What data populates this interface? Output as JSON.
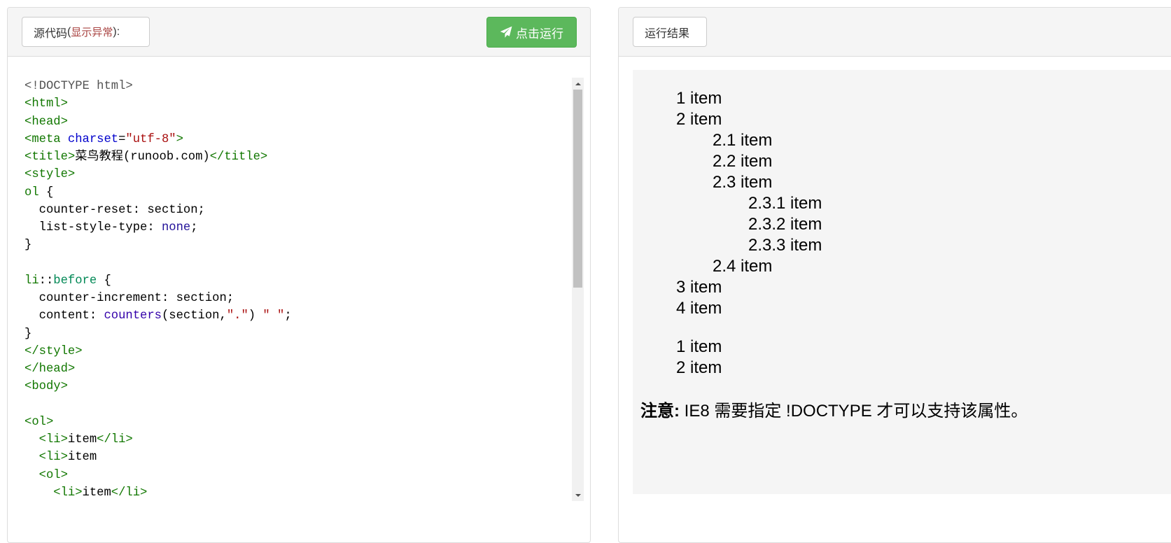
{
  "source_panel": {
    "label": "源代码",
    "error_open": " (",
    "error_link": "显示异常",
    "error_close": ")",
    "label_colon": ":",
    "run_button": "点击运行",
    "code_lines": [
      [
        {
          "t": "doc",
          "v": "<!DOCTYPE html>"
        }
      ],
      [
        {
          "t": "tag",
          "v": "<html>"
        }
      ],
      [
        {
          "t": "tag",
          "v": "<head>"
        }
      ],
      [
        {
          "t": "tag",
          "v": "<meta "
        },
        {
          "t": "attr",
          "v": "charset"
        },
        {
          "t": "",
          "v": "="
        },
        {
          "t": "str",
          "v": "\"utf-8\""
        },
        {
          "t": "tag",
          "v": ">"
        }
      ],
      [
        {
          "t": "tag",
          "v": "<title>"
        },
        {
          "t": "",
          "v": "菜鸟教程(runoob.com)"
        },
        {
          "t": "tag",
          "v": "</title>"
        }
      ],
      [
        {
          "t": "tag",
          "v": "<style>"
        }
      ],
      [
        {
          "t": "sel",
          "v": "ol"
        },
        {
          "t": "",
          "v": " {"
        }
      ],
      [
        {
          "t": "",
          "v": "  counter-reset: section;"
        }
      ],
      [
        {
          "t": "",
          "v": "  list-style-type: "
        },
        {
          "t": "kw",
          "v": "none"
        },
        {
          "t": "",
          "v": ";"
        }
      ],
      [
        {
          "t": "",
          "v": "}"
        }
      ],
      [
        {
          "t": "",
          "v": ""
        }
      ],
      [
        {
          "t": "sel",
          "v": "li"
        },
        {
          "t": "",
          "v": "::"
        },
        {
          "t": "pseudo",
          "v": "before"
        },
        {
          "t": "",
          "v": " {"
        }
      ],
      [
        {
          "t": "",
          "v": "  counter-increment: section;"
        }
      ],
      [
        {
          "t": "",
          "v": "  content: "
        },
        {
          "t": "fn",
          "v": "counters"
        },
        {
          "t": "",
          "v": "(section,"
        },
        {
          "t": "str",
          "v": "\".\""
        },
        {
          "t": "",
          "v": ") "
        },
        {
          "t": "str",
          "v": "\" \""
        },
        {
          "t": "",
          "v": ";"
        }
      ],
      [
        {
          "t": "",
          "v": "}"
        }
      ],
      [
        {
          "t": "tag",
          "v": "</style>"
        }
      ],
      [
        {
          "t": "tag",
          "v": "</head>"
        }
      ],
      [
        {
          "t": "tag",
          "v": "<body>"
        }
      ],
      [
        {
          "t": "",
          "v": ""
        }
      ],
      [
        {
          "t": "tag",
          "v": "<ol>"
        }
      ],
      [
        {
          "t": "",
          "v": "  "
        },
        {
          "t": "tag",
          "v": "<li>"
        },
        {
          "t": "",
          "v": "item"
        },
        {
          "t": "tag",
          "v": "</li>"
        }
      ],
      [
        {
          "t": "",
          "v": "  "
        },
        {
          "t": "tag",
          "v": "<li>"
        },
        {
          "t": "",
          "v": "item"
        }
      ],
      [
        {
          "t": "",
          "v": "  "
        },
        {
          "t": "tag",
          "v": "<ol>"
        }
      ],
      [
        {
          "t": "",
          "v": "    "
        },
        {
          "t": "tag",
          "v": "<li>"
        },
        {
          "t": "",
          "v": "item"
        },
        {
          "t": "tag",
          "v": "</li>"
        }
      ]
    ]
  },
  "result_panel": {
    "label": "运行结果",
    "items": [
      {
        "text": "1 item",
        "level": 1,
        "group": 1
      },
      {
        "text": "2 item",
        "level": 1,
        "group": 1
      },
      {
        "text": "2.1 item",
        "level": 2,
        "group": 1
      },
      {
        "text": "2.2 item",
        "level": 2,
        "group": 1
      },
      {
        "text": "2.3 item",
        "level": 2,
        "group": 1
      },
      {
        "text": "2.3.1 item",
        "level": 3,
        "group": 1
      },
      {
        "text": "2.3.2 item",
        "level": 3,
        "group": 1
      },
      {
        "text": "2.3.3 item",
        "level": 3,
        "group": 1
      },
      {
        "text": "2.4 item",
        "level": 2,
        "group": 1
      },
      {
        "text": "3 item",
        "level": 1,
        "group": 1
      },
      {
        "text": "4 item",
        "level": 1,
        "group": 1
      },
      {
        "text": "1 item",
        "level": 1,
        "group": 2
      },
      {
        "text": "2 item",
        "level": 1,
        "group": 2
      }
    ],
    "note_bold": "注意:",
    "note_text": " IE8 需要指定 !DOCTYPE 才可以支持该属性。"
  },
  "colors": {
    "run_button": "#5cb85c",
    "error_link": "#a94442",
    "code_tag": "#117700",
    "code_string": "#aa1111",
    "code_attribute": "#0000cc",
    "code_keyword": "#221199"
  },
  "icons": {
    "run_button_icon": "paper-plane-icon"
  }
}
